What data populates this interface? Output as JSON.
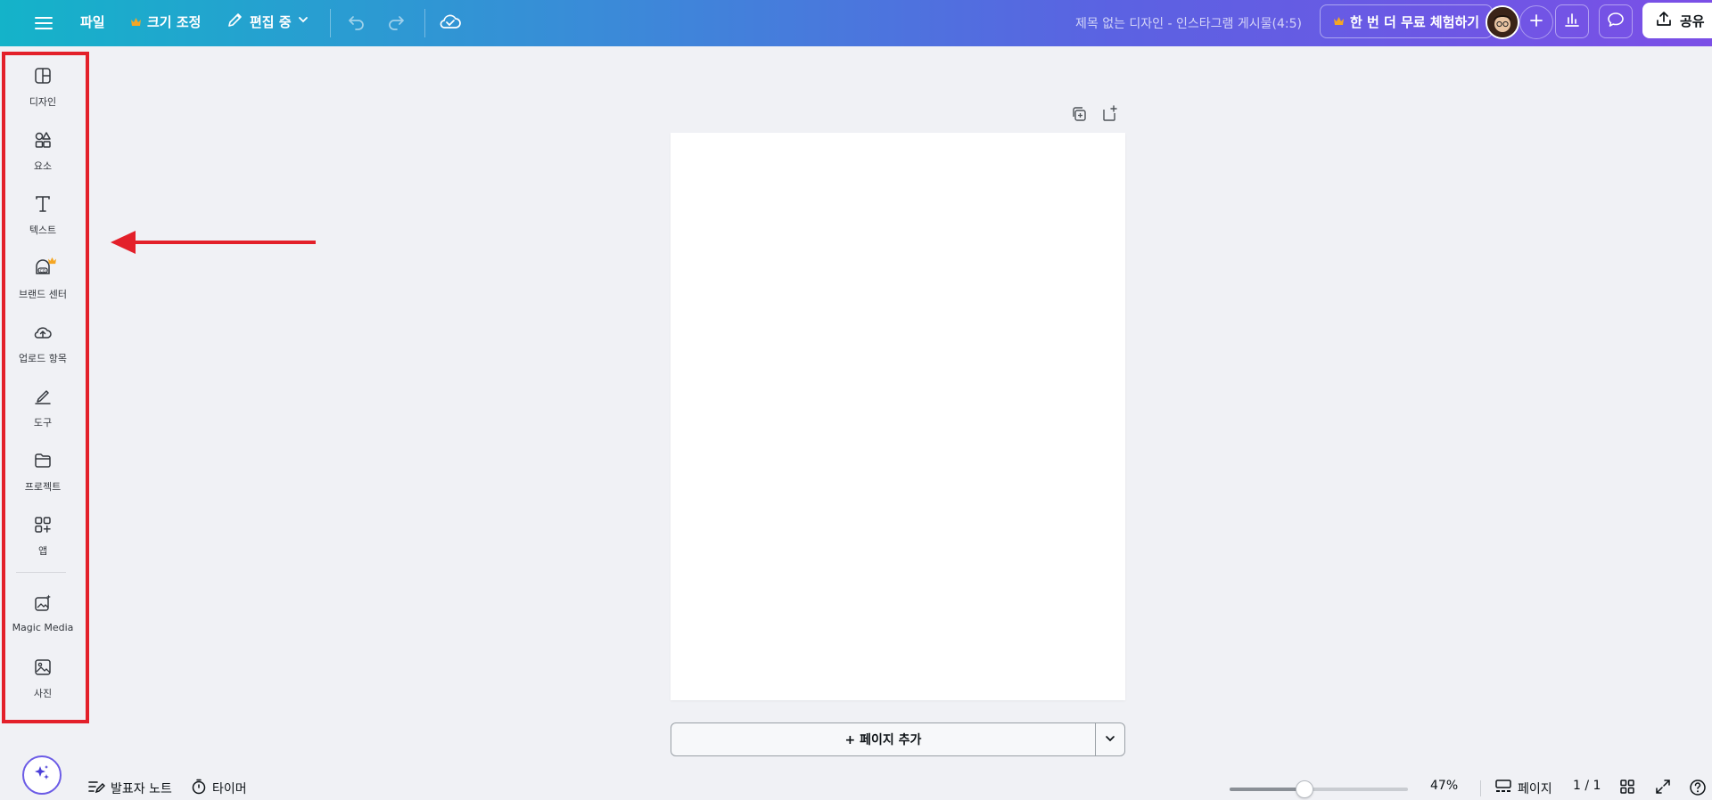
{
  "topbar": {
    "file_label": "파일",
    "resize_label": "크기 조정",
    "edit_label": "편집 중",
    "doc_title": "제목 없는 디자인 - 인스타그램 게시물(4:5)",
    "trial_label": "한 번 더 무료 체험하기",
    "share_label": "공유"
  },
  "sidebar": {
    "items": [
      {
        "label": "디자인",
        "icon": "design-icon"
      },
      {
        "label": "요소",
        "icon": "elements-icon"
      },
      {
        "label": "텍스트",
        "icon": "text-icon"
      },
      {
        "label": "브랜드 센터",
        "icon": "brand-icon"
      },
      {
        "label": "업로드 항목",
        "icon": "upload-icon"
      },
      {
        "label": "도구",
        "icon": "draw-icon"
      },
      {
        "label": "프로젝트",
        "icon": "folder-icon"
      },
      {
        "label": "앱",
        "icon": "apps-icon"
      },
      {
        "label": "Magic Media",
        "icon": "magic-media-icon"
      },
      {
        "label": "사진",
        "icon": "photo-icon"
      }
    ]
  },
  "canvas": {
    "add_page_label": "+ 페이지 추가"
  },
  "bottombar": {
    "notes_label": "발표자 노트",
    "timer_label": "타이머",
    "zoom": "47%",
    "zoom_fraction": 0.42,
    "pages_label": "페이지",
    "page_count": "1 / 1"
  },
  "colors": {
    "gradient_start": "#14b3c9",
    "gradient_end": "#7b4fe6",
    "highlight": "#e3202a",
    "crown": "#f5a623"
  }
}
